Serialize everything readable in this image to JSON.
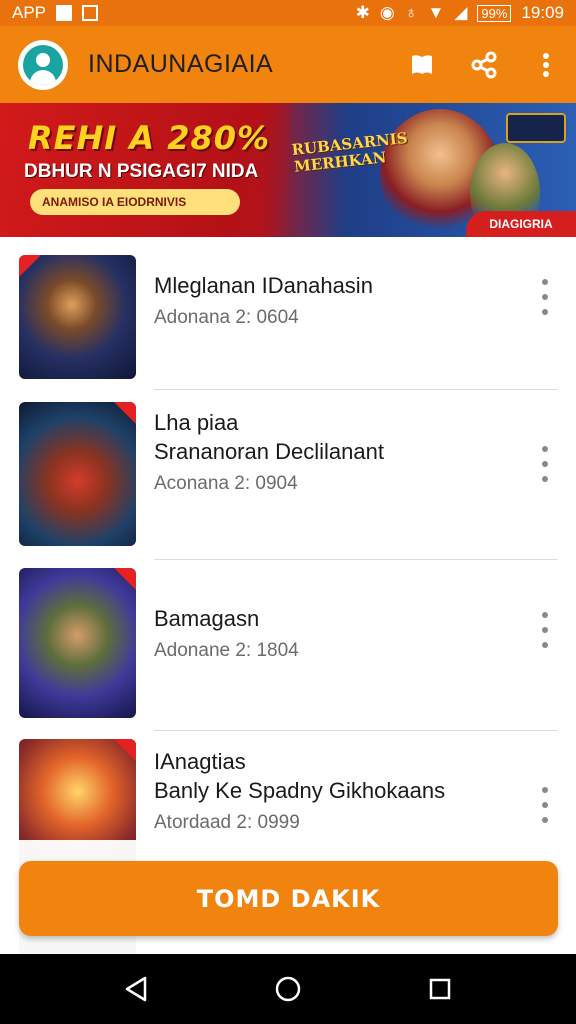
{
  "status_bar": {
    "left_label": "APP",
    "battery_text": "99%",
    "time": "19:09"
  },
  "app_bar": {
    "title": "INDAUNAGIAIA",
    "icons": [
      "bookmark-icon",
      "share-icon",
      "more-vert-icon"
    ]
  },
  "banner": {
    "headline": "REHI A 280%",
    "subline": "DBHUR N PSIGAGI7 NIDA",
    "pill_text": "ANAMISO IA EIODRNIVIS",
    "game_logo": "RUBASARNIS MERHKAN",
    "corner_text": "DIAGIGRIA"
  },
  "games": [
    {
      "title": "Mleglanan IDanahasin",
      "meta": "Adonana 2: 0604"
    },
    {
      "title": "Lha piaa\nSrananoran Declilanant",
      "meta": "Aconana 2: 0904"
    },
    {
      "title": "Bamagasn",
      "meta": "Adonane 2: 1804"
    },
    {
      "title": "IAnagtias\nBanly Ke Spadny Gikhokaans",
      "meta": "Atordaad 2: 0999"
    }
  ],
  "cta": {
    "label": "TOMD DAKIK"
  },
  "nav": [
    "back-icon",
    "home-icon",
    "recents-icon"
  ],
  "colors": {
    "accent": "#f0840f",
    "status_bar": "#e9720c",
    "banner_red": "#c3121a",
    "banner_blue": "#2b5fb5"
  }
}
